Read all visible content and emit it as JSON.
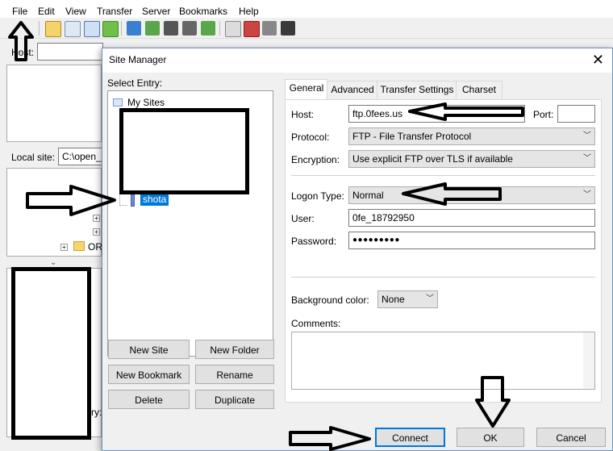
{
  "menu": [
    "File",
    "Edit",
    "View",
    "Transfer",
    "Server",
    "Bookmarks",
    "Help"
  ],
  "main": {
    "host_label": "Host:",
    "local_site_label": "Local site:",
    "local_site_value": "C:\\open_",
    "tree_partial": "OR",
    "bottom_partial": "ry:"
  },
  "dialog": {
    "title": "Site Manager",
    "close": "✕",
    "select_entry_label": "Select Entry:",
    "tree": {
      "root": "My Sites",
      "selected": "shota"
    },
    "buttons": {
      "new_site": "New Site",
      "new_folder": "New Folder",
      "new_bookmark": "New Bookmark",
      "rename": "Rename",
      "delete": "Delete",
      "duplicate": "Duplicate",
      "connect": "Connect",
      "ok": "OK",
      "cancel": "Cancel"
    },
    "tabs": [
      "General",
      "Advanced",
      "Transfer Settings",
      "Charset"
    ],
    "active_tab": "General",
    "general": {
      "host_label": "Host:",
      "host_value": "ftp.0fees.us",
      "port_label": "Port:",
      "port_value": "",
      "protocol_label": "Protocol:",
      "protocol_value": "FTP - File Transfer Protocol",
      "encryption_label": "Encryption:",
      "encryption_value": "Use explicit FTP over TLS if available",
      "logon_type_label": "Logon Type:",
      "logon_type_value": "Normal",
      "user_label": "User:",
      "user_value": "0fe_18792950",
      "password_label": "Password:",
      "password_value": "●●●●●●●●●",
      "bg_color_label": "Background color:",
      "bg_color_value": "None",
      "comments_label": "Comments:",
      "comments_value": ""
    }
  }
}
